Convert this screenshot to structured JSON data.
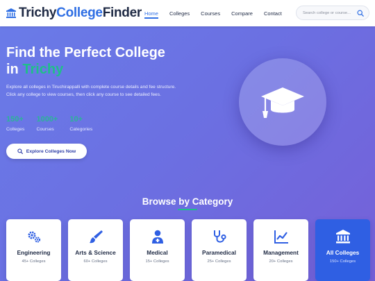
{
  "brand": {
    "part1": "Trichy",
    "part2": "College",
    "part3": "Finder"
  },
  "nav": [
    {
      "label": "Home",
      "active": true
    },
    {
      "label": "Colleges",
      "active": false
    },
    {
      "label": "Courses",
      "active": false
    },
    {
      "label": "Compare",
      "active": false
    },
    {
      "label": "Contact",
      "active": false
    }
  ],
  "search": {
    "placeholder": "Search college or course...",
    "icon": "search-icon"
  },
  "hero": {
    "title_line1": "Find the Perfect College",
    "title_in": "in ",
    "title_accent": "Trichy",
    "description": "Explore all colleges in Tiruchirappalli with complete course details and fee structure. Click any college to view courses, then click any course to see detailed fees.",
    "stats": [
      {
        "number": "150+",
        "label": "Colleges"
      },
      {
        "number": "1000+",
        "label": "Courses"
      },
      {
        "number": "10+",
        "label": "Categories"
      }
    ],
    "button_label": "Explore Colleges Now",
    "illustration": "graduation-cap-icon"
  },
  "categories_section": {
    "title": "Browse by Category",
    "cards": [
      {
        "name": "Engineering",
        "count": "45+ Colleges",
        "icon": "cogs-icon",
        "active": false
      },
      {
        "name": "Arts & Science",
        "count": "60+ Colleges",
        "icon": "paintbrush-icon",
        "active": false
      },
      {
        "name": "Medical",
        "count": "15+ Colleges",
        "icon": "doctor-icon",
        "active": false
      },
      {
        "name": "Paramedical",
        "count": "25+ Colleges",
        "icon": "stethoscope-icon",
        "active": false
      },
      {
        "name": "Management",
        "count": "20+ Colleges",
        "icon": "chart-line-icon",
        "active": false
      },
      {
        "name": "All Colleges",
        "count": "150+ Colleges",
        "icon": "university-icon",
        "active": true
      }
    ]
  },
  "colors": {
    "primary": "#2f6fe4",
    "accent": "#1fbf8a",
    "dark": "#1f2a44"
  }
}
